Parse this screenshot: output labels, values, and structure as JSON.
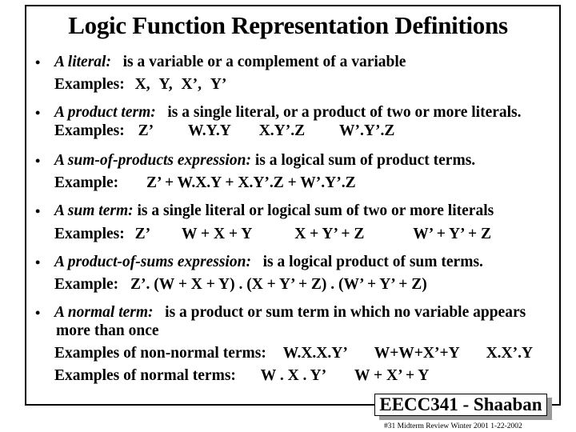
{
  "title": "Logic Function Representation Definitions",
  "sections": [
    {
      "term": "A literal:",
      "definition": "is a variable or a complement of a variable",
      "example_label": "Examples:",
      "examples": [
        "X,",
        "Y,",
        "X’,",
        "Y’"
      ]
    },
    {
      "term": "A product term:",
      "definition": "is a single literal, or a product of two or more literals.",
      "example_label": "Examples:",
      "examples": [
        "Z’",
        "W.Y.Y",
        "X.Y’.Z",
        "W’.Y’.Z"
      ]
    },
    {
      "term": "A sum-of-products expression:",
      "definition": "is a logical sum of product terms.",
      "example_label": "Example:",
      "examples": [
        "Z’ + W.X.Y + X.Y’.Z + W’.Y’.Z"
      ]
    },
    {
      "term": "A sum term:",
      "definition": "is a single literal or logical sum of two or more literals",
      "example_label": "Examples:",
      "examples": [
        "Z’",
        "W + X + Y",
        "X + Y’ + Z",
        "W’ + Y’ + Z"
      ]
    },
    {
      "term": "A product-of-sums expression:",
      "definition": "is a logical product of sum terms.",
      "example_label": "Example:",
      "examples": [
        "Z’. (W + X + Y) . (X + Y’ + Z) . (W’ + Y’ + Z)"
      ]
    },
    {
      "term": "A normal term:",
      "definition": "is a product or sum term in which no variable appears",
      "definition_cont": "more than once",
      "non_normal_label": "Examples of non-normal terms:",
      "non_normal_examples": [
        "W.X.X.Y’",
        "W+W+X’+Y",
        "X.X’.Y"
      ],
      "normal_label": "Examples of normal terms:",
      "normal_examples": [
        "W . X . Y’",
        "W + X’ + Y"
      ]
    }
  ],
  "bullet": "•",
  "footer": {
    "badge": "EECC341 - Shaaban",
    "note": "#31  Midterm Review  Winter 2001  1-22-2002"
  }
}
